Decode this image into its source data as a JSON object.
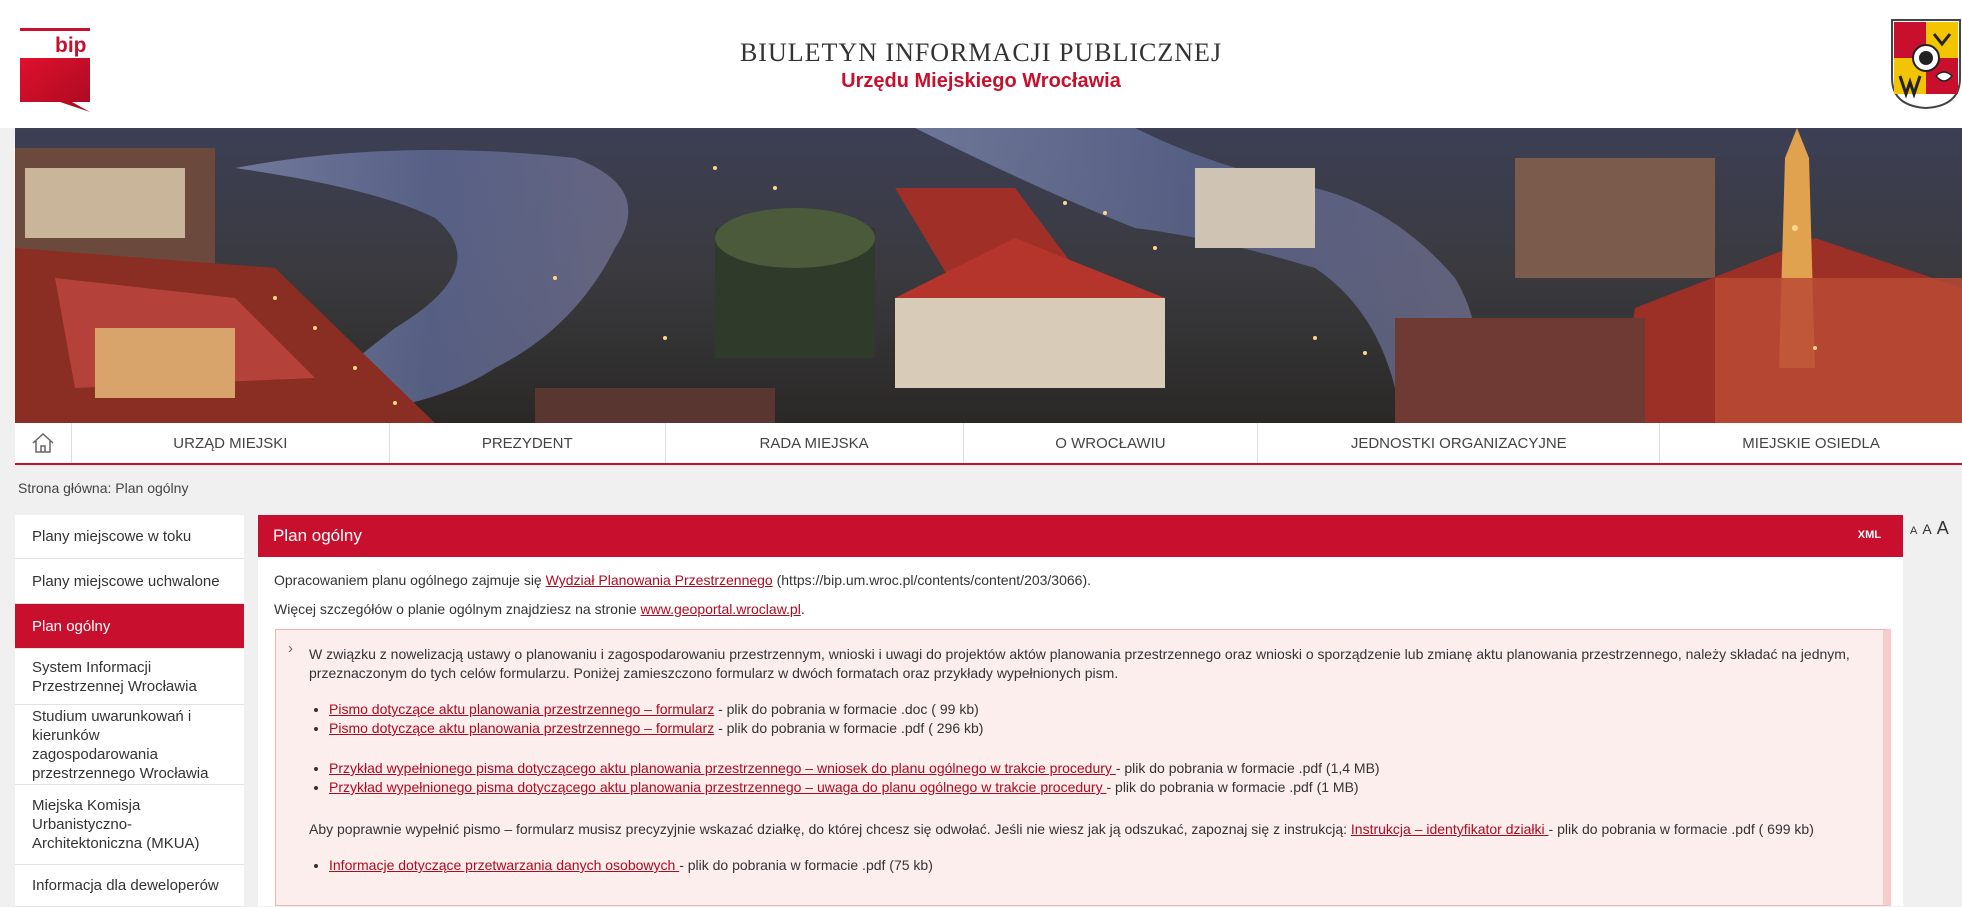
{
  "header": {
    "logo_text": "bip",
    "title": "BIULETYN INFORMACJI PUBLICZNEJ",
    "subtitle": "Urzędu Miejskiego Wrocławia"
  },
  "nav": {
    "items": [
      {
        "label": "URZĄD MIEJSKI"
      },
      {
        "label": "PREZYDENT"
      },
      {
        "label": "RADA MIEJSKA"
      },
      {
        "label": "O WROCŁAWIU"
      },
      {
        "label": "JEDNOSTKI ORGANIZACYJNE"
      },
      {
        "label": "MIEJSKIE OSIEDLA"
      }
    ]
  },
  "breadcrumb": "Strona główna: Plan ogólny",
  "sidebar": {
    "items": [
      {
        "label": "Plany miejscowe w toku",
        "active": false
      },
      {
        "label": "Plany miejscowe uchwalone",
        "active": false
      },
      {
        "label": "Plan ogólny",
        "active": true
      },
      {
        "label": "System Informacji Przestrzennej Wrocławia",
        "active": false
      },
      {
        "label": "Studium uwarunkowań i kierunków zagospodarowania przestrzennego Wrocławia",
        "active": false
      },
      {
        "label": "Miejska Komisja Urbanistyczno-Architektoniczna (MKUA)",
        "active": false
      },
      {
        "label": "Informacja dla deweloperów",
        "active": false
      }
    ]
  },
  "font_controls": [
    "A",
    "A",
    "A"
  ],
  "main": {
    "title": "Plan ogólny",
    "xml": "XML",
    "p1_before": "Opracowaniem planu ogólnego zajmuje się ",
    "p1_link": "Wydział Planowania Przestrzennego",
    "p1_after": " (https://bip.um.wroc.pl/contents/content/203/3066).",
    "p2_before": "Więcej szczegółów o planie ogólnym znajdziesz na stronie ",
    "p2_link": "www.geoportal.wroclaw.pl",
    "p2_after": ".",
    "notice": {
      "intro": "W związku z nowelizacją ustawy o planowaniu i zagospodarowaniu przestrzennym, wnioski i uwagi do projektów aktów planowania przestrzennego oraz wnioski o sporządzenie lub zmianę aktu planowania przestrzennego, należy składać na jednym, przeznaczonym do tych celów formularzu. Poniżej zamieszczono formularz w dwóch formatach oraz przykłady wypełnionych pism.",
      "group1": [
        {
          "link": "Pismo dotyczące aktu planowania przestrzennego – formularz",
          "after": " - plik do pobrania w formacie .doc ( 99 kb)"
        },
        {
          "link": "Pismo dotyczące aktu planowania przestrzennego – formularz",
          "after": " - plik do pobrania w formacie .pdf ( 296 kb)"
        }
      ],
      "group2": [
        {
          "link": "Przykład wypełnionego pisma dotyczącego aktu planowania przestrzennego – wniosek do planu ogólnego w trakcie procedury ",
          "after": " - plik do pobrania w formacie .pdf (1,4 MB)"
        },
        {
          "link": "Przykład wypełnionego pisma dotyczącego aktu planowania przestrzennego – uwaga do planu ogólnego w trakcie procedury ",
          "after": "- plik do pobrania w formacie .pdf (1 MB)"
        }
      ],
      "aby_before": "Aby poprawnie wypełnić pismo – formularz musisz precyzyjnie wskazać działkę, do której chcesz się odwołać. Jeśli nie wiesz jak ją odszukać, zapoznaj się z  instrukcją: ",
      "aby_link": "Instrukcja – identyfikator działki ",
      "aby_after": "- plik do pobrania w formacie .pdf ( 699 kb)",
      "group3": [
        {
          "link": "Informacje dotyczące przetwarzania danych osobowych ",
          "after": "- plik do pobrania w formacie .pdf (75 kb)"
        }
      ]
    }
  },
  "colors": {
    "accent": "#c8102e",
    "notice_bg": "#fdeeee"
  },
  "icons": [
    "home-icon",
    "chevron-right-icon",
    "city-crest-icon"
  ]
}
